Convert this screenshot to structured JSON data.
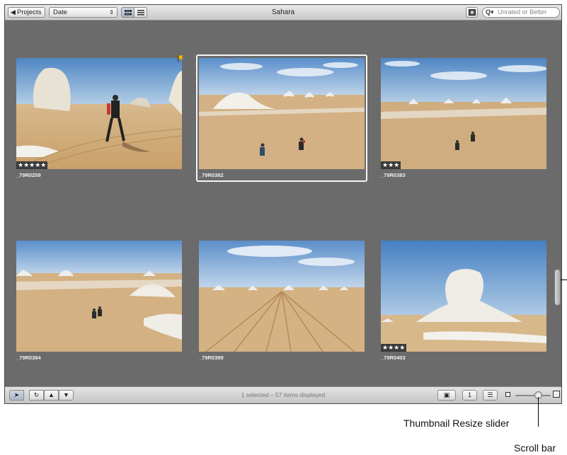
{
  "toolbar": {
    "projects_label": "Projects",
    "sort_value": "Date",
    "title": "Sahara",
    "filter_placeholder": "Unrated or Better"
  },
  "thumbnails": [
    {
      "name": "_79R0259",
      "rating": "★★★★★",
      "flagged": true,
      "selected": false
    },
    {
      "name": "_79R0382",
      "rating": "",
      "flagged": false,
      "selected": true
    },
    {
      "name": "_79R0383",
      "rating": "★★★",
      "flagged": false,
      "selected": false
    },
    {
      "name": "_79R0384",
      "rating": "",
      "flagged": false,
      "selected": false
    },
    {
      "name": "_79R0399",
      "rating": "",
      "flagged": false,
      "selected": false
    },
    {
      "name": "_79R0403",
      "rating": "★★★★",
      "flagged": false,
      "selected": false
    }
  ],
  "status": {
    "text": "1 selected – 57 items displayed"
  },
  "callouts": {
    "slider": "Thumbnail Resize slider",
    "scrollbar": "Scroll bar"
  },
  "colors": {
    "browser_bg": "#6b6b6b",
    "selection": "#f5f5f5"
  }
}
